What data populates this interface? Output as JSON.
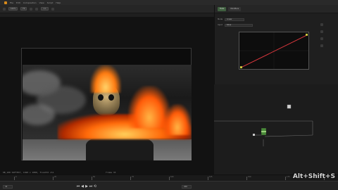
{
  "menubar": {
    "items": [
      "File",
      "Edit",
      "Composition",
      "View",
      "Script",
      "Help"
    ]
  },
  "viewer": {
    "toolbar_chips": [
      "100%",
      "Fit",
      "1:1"
    ],
    "info_left": "0B_100 SSFTEST, 1920 x 1080, float32 ch1",
    "info_right": "frame 33"
  },
  "inspector": {
    "tabs": [
      "Tools",
      "Modifiers"
    ],
    "rows": [
      {
        "label": "Mode",
        "value": "Linear"
      },
      {
        "label": "Input",
        "value": "Value"
      }
    ],
    "curve": {
      "line_color": "#e0383e"
    }
  },
  "node_graph": {
    "nodes": [
      "BrightnessContrast",
      "Merge"
    ]
  },
  "timeline": {
    "tick_labels": [
      "0",
      "25",
      "50",
      "75",
      "100",
      "125",
      "150",
      "175",
      "200"
    ],
    "controls": [
      "⏮",
      "◀",
      "▶",
      "⏭",
      "⟲"
    ],
    "frame_field": "33",
    "end_field": "200"
  },
  "watermark": {
    "text": "Alt+Shift+S"
  },
  "colors": {
    "accent": "#d98a1a",
    "fire": "#ff7a10",
    "curve": "#e0383e"
  }
}
